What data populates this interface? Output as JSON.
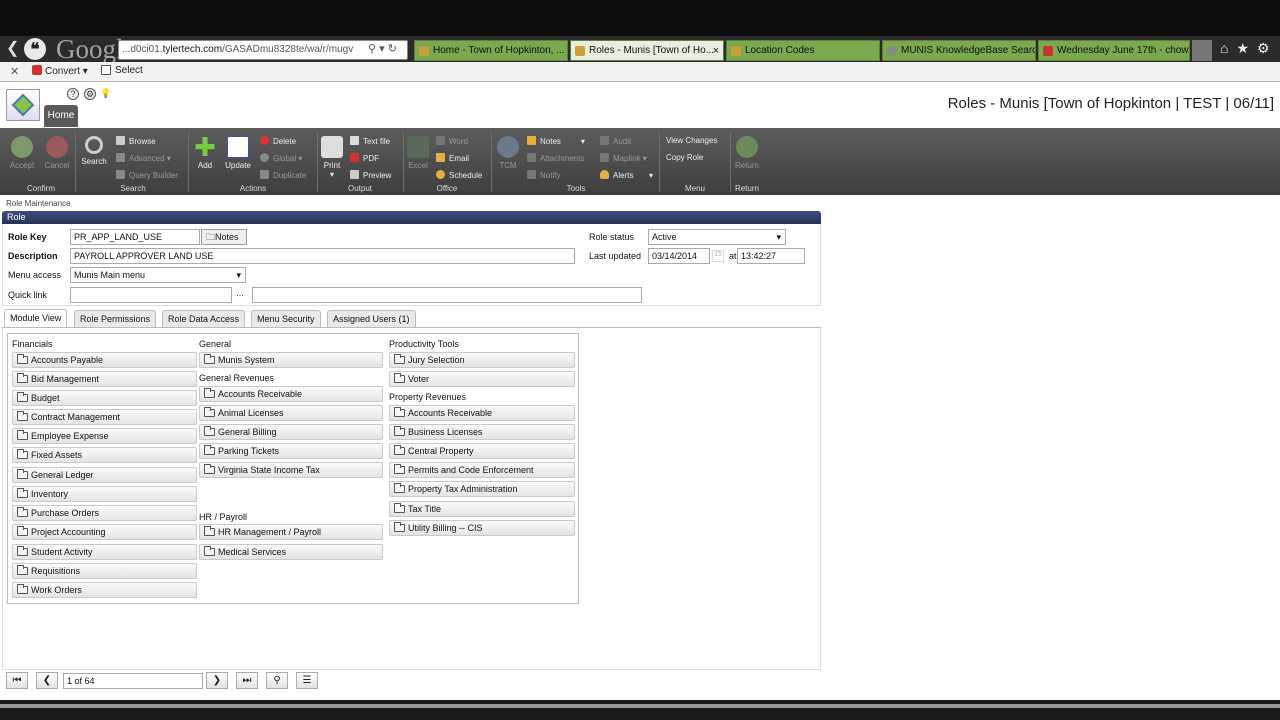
{
  "browser": {
    "url_prefix": "...d0ci01.",
    "url_host": "tylertech.com",
    "url_path": "/GASADmu8328te/wa/r/mugv",
    "google_logo": "Google",
    "tabs": [
      {
        "label": "Home - Town of Hopkinton, ...",
        "active": false
      },
      {
        "label": "Roles - Munis [Town of Ho...",
        "active": true
      },
      {
        "label": "Location Codes",
        "active": false
      },
      {
        "label": "MUNIS KnowledgeBase Searc...",
        "active": false
      },
      {
        "label": "Wednesday June 17th - chow...",
        "active": false
      }
    ],
    "toolbar2": {
      "convert": "Convert",
      "select": "Select"
    }
  },
  "app": {
    "home_tab": "Home",
    "title": "Roles - Munis [Town of Hopkinton | TEST | 06/11]"
  },
  "ribbon": {
    "confirm": {
      "group": "Confirm",
      "accept": "Accept",
      "cancel": "Cancel"
    },
    "search": {
      "group": "Search",
      "search": "Search",
      "browse": "Browse",
      "advanced": "Advanced",
      "query_builder": "Query Builder"
    },
    "actions": {
      "group": "Actions",
      "add": "Add",
      "update": "Update",
      "delete": "Delete",
      "global": "Global",
      "duplicate": "Duplicate"
    },
    "output": {
      "group": "Output",
      "print": "Print",
      "text_file": "Text file",
      "pdf": "PDF",
      "preview": "Preview"
    },
    "office": {
      "group": "Office",
      "excel": "Excel",
      "word": "Word",
      "email": "Email",
      "schedule": "Schedule"
    },
    "tools": {
      "group": "Tools",
      "tcm": "TCM",
      "notes": "Notes",
      "attachments": "Attachments",
      "notify": "Notify",
      "audit": "Audit",
      "maplink": "Maplink",
      "alerts": "Alerts"
    },
    "menu": {
      "group": "Menu",
      "view_changes": "View Changes",
      "copy_role": "Copy Role"
    },
    "return": {
      "group": "Return",
      "return": "Return"
    }
  },
  "form": {
    "breadcrumb": "Role Maintenance",
    "section": "Role",
    "role_key_label": "Role Key",
    "role_key": "PR_APP_LAND_USE",
    "notes_btn": "Notes",
    "description_label": "Description",
    "description": "PAYROLL APPROVER LAND USE",
    "menu_access_label": "Menu access",
    "menu_access": "Munis Main menu",
    "quick_link_label": "Quick link",
    "quick_link": "",
    "quick_link_desc": "",
    "ellipsis": "...",
    "role_status_label": "Role status",
    "role_status": "Active",
    "last_updated_label": "Last updated",
    "last_updated_date": "03/14/2014",
    "cal_day": "15",
    "at_label": "at",
    "last_updated_time": "13:42:27"
  },
  "tabs": [
    "Module View",
    "Role Permissions",
    "Role Data Access",
    "Menu Security",
    "Assigned Users (1)"
  ],
  "modules": {
    "financials": {
      "header": "Financials",
      "items": [
        "Accounts Payable",
        "Bid Management",
        "Budget",
        "Contract Management",
        "Employee Expense",
        "Fixed Assets",
        "General Ledger",
        "Inventory",
        "Purchase Orders",
        "Project Accounting",
        "Student Activity",
        "Requisitions",
        "Work Orders"
      ]
    },
    "general": {
      "header": "General",
      "items": [
        "Munis System"
      ]
    },
    "general_revenues": {
      "header": "General Revenues",
      "items": [
        "Accounts Receivable",
        "Animal Licenses",
        "General Billing",
        "Parking Tickets",
        "Virginia State Income Tax"
      ]
    },
    "hr_payroll": {
      "header": "HR / Payroll",
      "items": [
        "HR Management / Payroll",
        "Medical Services"
      ]
    },
    "productivity": {
      "header": "Productivity Tools",
      "items": [
        "Jury Selection",
        "Voter"
      ]
    },
    "property_revenues": {
      "header": "Property Revenues",
      "items": [
        "Accounts Receivable",
        "Business Licenses",
        "Central Property",
        "Permits and Code Enforcement",
        "Property Tax Administration",
        "Tax Title",
        "Utility Billing -- CIS"
      ]
    }
  },
  "pager": {
    "text": "1 of 64"
  }
}
